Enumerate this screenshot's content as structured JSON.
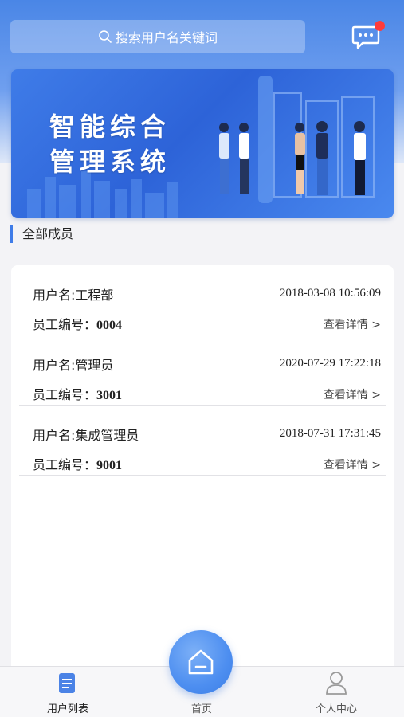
{
  "search": {
    "placeholder": "搜索用户名关键词"
  },
  "banner": {
    "title_line1": "智能综合",
    "title_line2": "管理系统"
  },
  "section": {
    "title": "全部成员"
  },
  "members": [
    {
      "username_label": "用户名:",
      "username": "工程部",
      "time": "2018-03-08 10:56:09",
      "empno_label": "员工编号：",
      "empno": "0004",
      "detail": "查看详情 >"
    },
    {
      "username_label": "用户名:",
      "username": "管理员",
      "time": "2020-07-29 17:22:18",
      "empno_label": "员工编号：",
      "empno": "3001",
      "detail": "查看详情 >"
    },
    {
      "username_label": "用户名:",
      "username": "集成管理员",
      "time": "2018-07-31 17:31:45",
      "empno_label": "员工编号：",
      "empno": "9001",
      "detail": "查看详情 >"
    }
  ],
  "tabs": {
    "user_list": "用户列表",
    "home": "首页",
    "profile": "个人中心"
  },
  "colors": {
    "accent": "#3f7ce8",
    "badge": "#ff3b3b"
  }
}
